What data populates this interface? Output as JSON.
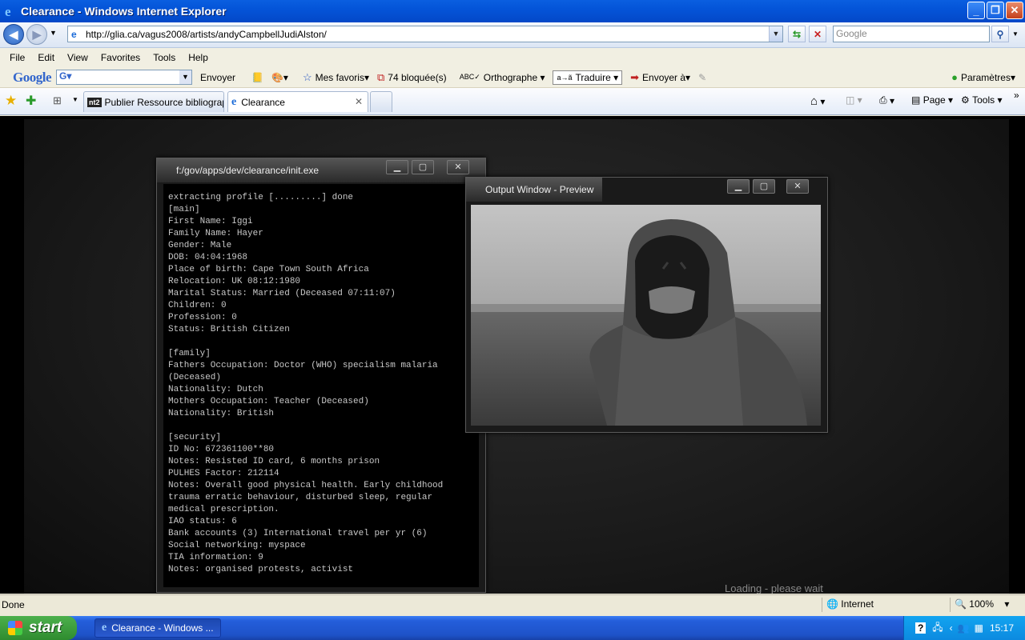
{
  "window": {
    "title": "Clearance - Windows Internet Explorer"
  },
  "nav": {
    "url": "http://glia.ca/vagus2008/artists/andyCampbellJudiAlston/",
    "search_placeholder": "Google"
  },
  "menu": [
    "File",
    "Edit",
    "View",
    "Favorites",
    "Tools",
    "Help"
  ],
  "googlebar": {
    "logo": "Google",
    "send": "Envoyer",
    "favorites": "Mes favoris",
    "blocked": "74 bloquée(s)",
    "spelling": "Orthographe",
    "translate": "Traduire",
    "send_to": "Envoyer à",
    "settings": "Paramètres"
  },
  "tabs": [
    {
      "label": "Publier Ressource bibliograph..."
    },
    {
      "label": "Clearance"
    }
  ],
  "toolbar": {
    "page": "Page",
    "tools": "Tools"
  },
  "terminal": {
    "title": "f:/gov/apps/dev/clearance/init.exe",
    "lines": [
      "extracting profile [.........] done",
      "[main]",
      "First Name: Iggi",
      "Family Name: Hayer",
      "Gender: Male",
      "DOB: 04:04:1968",
      "Place of birth: Cape Town South Africa",
      "Relocation: UK 08:12:1980",
      "Marital Status: Married (Deceased 07:11:07)",
      "Children: 0",
      "Profession: 0",
      "Status: British Citizen",
      "",
      "[family]",
      "Fathers Occupation: Doctor (WHO) specialism malaria",
      "(Deceased)",
      "Nationality: Dutch",
      "Mothers Occupation: Teacher (Deceased)",
      "Nationality: British",
      "",
      "[security]",
      "ID No: 672361100**80",
      "Notes: Resisted ID card, 6 months prison",
      "PULHES Factor: 212114",
      "Notes: Overall good physical health. Early childhood",
      "trauma erratic behaviour, disturbed sleep, regular",
      "medical prescription.",
      "IAO status: 6",
      "Bank accounts (3) International travel per yr (6)",
      "Social networking: myspace",
      "TIA information: 9",
      "Notes: organised protests, activist"
    ]
  },
  "preview": {
    "title": "Output Window - Preview"
  },
  "loading": "Loading - please wait",
  "status": {
    "text": "Done",
    "zone": "Internet",
    "zoom": "100%"
  },
  "taskbar": {
    "start": "start",
    "item": "Clearance - Windows ...",
    "clock": "15:17"
  }
}
